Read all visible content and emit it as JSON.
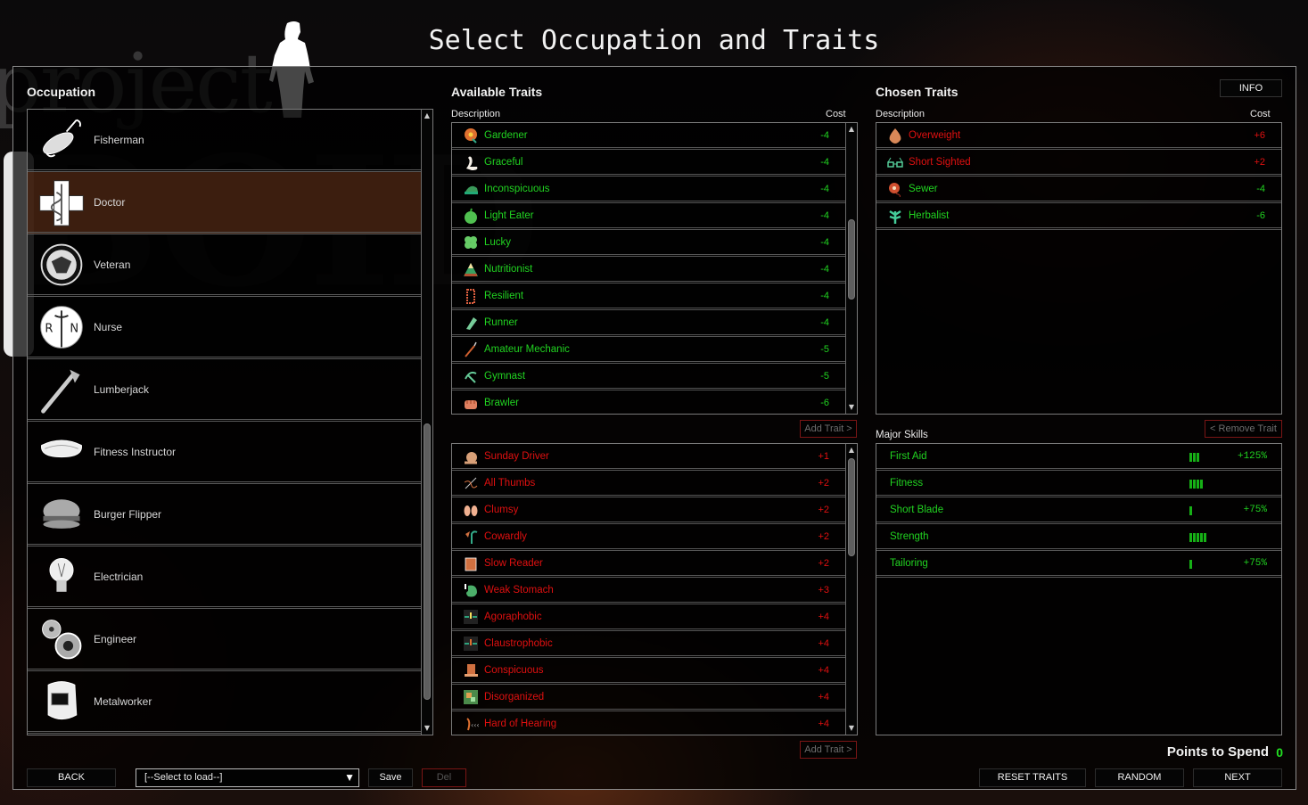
{
  "page": {
    "title": "Select Occupation and Traits",
    "background_logo_text": "project"
  },
  "colors": {
    "positive_trait": "#21d321",
    "negative_trait": "#e01010",
    "selected_row": "#50281a",
    "points_value": "#22e022"
  },
  "occupation": {
    "title": "Occupation",
    "items": [
      {
        "label": "Fisherman",
        "icon": "fishing-lure-icon",
        "selected": false
      },
      {
        "label": "Doctor",
        "icon": "medical-cross-icon",
        "selected": true
      },
      {
        "label": "Veteran",
        "icon": "army-seal-icon",
        "selected": false
      },
      {
        "label": "Nurse",
        "icon": "nurse-caduceus-icon",
        "selected": false
      },
      {
        "label": "Lumberjack",
        "icon": "axe-icon",
        "selected": false
      },
      {
        "label": "Fitness Instructor",
        "icon": "sweatband-icon",
        "selected": false
      },
      {
        "label": "Burger Flipper",
        "icon": "burger-icon",
        "selected": false
      },
      {
        "label": "Electrician",
        "icon": "lightbulb-icon",
        "selected": false
      },
      {
        "label": "Engineer",
        "icon": "gears-icon",
        "selected": false
      },
      {
        "label": "Metalworker",
        "icon": "welding-mask-icon",
        "selected": false
      }
    ]
  },
  "available_traits": {
    "title": "Available Traits",
    "col_description": "Description",
    "col_cost": "Cost",
    "add_trait_label": "Add Trait >",
    "positive": [
      {
        "label": "Gardener",
        "cost": "-4",
        "icon": "flower-icon"
      },
      {
        "label": "Graceful",
        "cost": "-4",
        "icon": "swan-icon"
      },
      {
        "label": "Inconspicuous",
        "cost": "-4",
        "icon": "cap-icon"
      },
      {
        "label": "Light Eater",
        "cost": "-4",
        "icon": "apple-icon"
      },
      {
        "label": "Lucky",
        "cost": "-4",
        "icon": "clover-icon"
      },
      {
        "label": "Nutritionist",
        "cost": "-4",
        "icon": "food-pyramid-icon"
      },
      {
        "label": "Resilient",
        "cost": "-4",
        "icon": "spring-icon"
      },
      {
        "label": "Runner",
        "cost": "-4",
        "icon": "shoe-icon"
      },
      {
        "label": "Amateur Mechanic",
        "cost": "-5",
        "icon": "wrench-icon"
      },
      {
        "label": "Gymnast",
        "cost": "-5",
        "icon": "gymnast-icon"
      },
      {
        "label": "Brawler",
        "cost": "-6",
        "icon": "fist-icon"
      }
    ],
    "negative": [
      {
        "label": "Sunday Driver",
        "cost": "+1",
        "icon": "snail-icon"
      },
      {
        "label": "All Thumbs",
        "cost": "+2",
        "icon": "needle-thread-icon"
      },
      {
        "label": "Clumsy",
        "cost": "+2",
        "icon": "footprints-icon"
      },
      {
        "label": "Cowardly",
        "cost": "+2",
        "icon": "wilted-flower-icon"
      },
      {
        "label": "Slow Reader",
        "cost": "+2",
        "icon": "book-icon"
      },
      {
        "label": "Weak Stomach",
        "cost": "+3",
        "icon": "stomach-icon"
      },
      {
        "label": "Agoraphobic",
        "cost": "+4",
        "icon": "agoraphobia-icon"
      },
      {
        "label": "Claustrophobic",
        "cost": "+4",
        "icon": "claustrophobia-icon"
      },
      {
        "label": "Conspicuous",
        "cost": "+4",
        "icon": "top-hat-icon"
      },
      {
        "label": "Disorganized",
        "cost": "+4",
        "icon": "mess-icon"
      },
      {
        "label": "Hard of Hearing",
        "cost": "+4",
        "icon": "ear-icon"
      }
    ]
  },
  "chosen_traits": {
    "title": "Chosen Traits",
    "info_label": "INFO",
    "col_description": "Description",
    "col_cost": "Cost",
    "remove_trait_label": "< Remove Trait",
    "items": [
      {
        "label": "Overweight",
        "cost": "+6",
        "type": "negative",
        "icon": "belly-icon"
      },
      {
        "label": "Short Sighted",
        "cost": "+2",
        "type": "negative",
        "icon": "glasses-icon"
      },
      {
        "label": "Sewer",
        "cost": "-4",
        "type": "positive",
        "icon": "thread-spool-icon"
      },
      {
        "label": "Herbalist",
        "cost": "-6",
        "type": "positive",
        "icon": "herb-icon"
      }
    ]
  },
  "major_skills": {
    "title": "Major Skills",
    "items": [
      {
        "label": "First Aid",
        "level": 3,
        "boost": "+125%"
      },
      {
        "label": "Fitness",
        "level": 4,
        "boost": ""
      },
      {
        "label": "Short Blade",
        "level": 1,
        "boost": "+75%"
      },
      {
        "label": "Strength",
        "level": 5,
        "boost": ""
      },
      {
        "label": "Tailoring",
        "level": 1,
        "boost": "+75%"
      }
    ]
  },
  "points": {
    "label": "Points to Spend",
    "value": "0"
  },
  "footer": {
    "back_label": "BACK",
    "load_select_value": "[--Select to load--]",
    "save_label": "Save",
    "del_label": "Del",
    "reset_traits_label": "RESET TRAITS",
    "random_label": "RANDOM",
    "next_label": "NEXT"
  }
}
